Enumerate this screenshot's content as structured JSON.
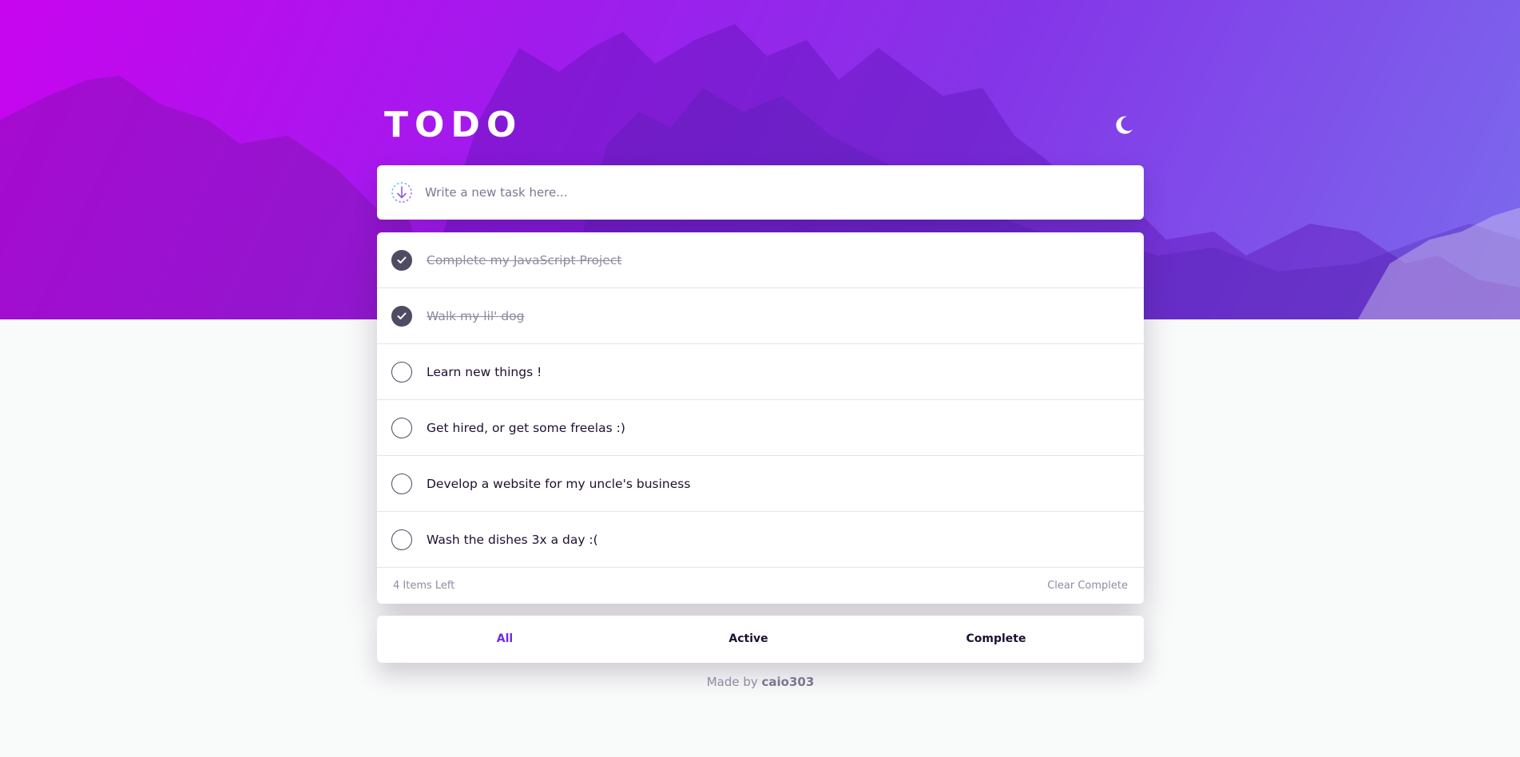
{
  "header": {
    "title": "TODO",
    "theme_icon": "moon-icon"
  },
  "new_task": {
    "placeholder": "Write a new task here...",
    "icon": "add-task-icon"
  },
  "todos": [
    {
      "text": "Complete my JavaScript Project",
      "done": true
    },
    {
      "text": "Walk my lil' dog",
      "done": true
    },
    {
      "text": "Learn new things !",
      "done": false
    },
    {
      "text": "Get hired, or get some freelas :)",
      "done": false
    },
    {
      "text": "Develop a website for my uncle's business",
      "done": false
    },
    {
      "text": "Wash the dishes 3x a day :(",
      "done": false
    }
  ],
  "list_footer": {
    "items_left": "4 Items Left",
    "clear_label": "Clear Complete"
  },
  "filters": {
    "all": "All",
    "active": "Active",
    "complete": "Complete",
    "selected": "all"
  },
  "credit": {
    "prefix": "Made by",
    "author": "caio303"
  },
  "colors": {
    "accent": "#6f2be8",
    "check_done": "#4f4b63",
    "hero_start": "#cd00f0",
    "hero_end": "#7678f0"
  }
}
